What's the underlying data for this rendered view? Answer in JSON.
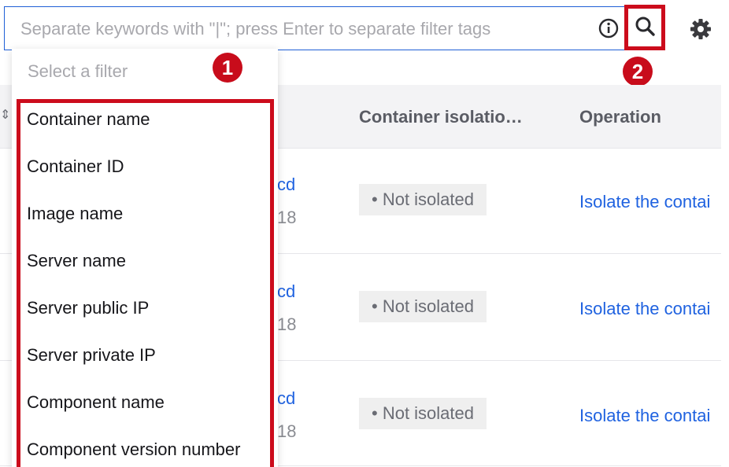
{
  "search": {
    "placeholder": "Separate keywords with \"|\"; press Enter to separate filter tags"
  },
  "icons": {
    "info": "info-circle-icon",
    "search": "search-icon",
    "settings": "gear-icon",
    "sort": "sort-icon"
  },
  "callouts": {
    "one": "1",
    "two": "2"
  },
  "colors": {
    "accent": "#1f5fd6",
    "highlight": "#cc0c1c",
    "link": "#1f62e0"
  },
  "table": {
    "columns": [
      "Container isolatio…",
      "Operation"
    ],
    "rows": [
      {
        "id_fragment": "cd",
        "sub_fragment": "18",
        "status": "• Not isolated",
        "operation": "Isolate the contai"
      },
      {
        "id_fragment": "cd",
        "sub_fragment": "18",
        "status": "• Not isolated",
        "operation": "Isolate the contai"
      },
      {
        "id_fragment": "cd",
        "sub_fragment": "18",
        "status": "• Not isolated",
        "operation": "Isolate the contai"
      }
    ]
  },
  "dropdown": {
    "header": "Select a filter",
    "items": [
      "Container name",
      "Container ID",
      "Image name",
      "Server name",
      "Server public IP",
      "Server private IP",
      "Component name",
      "Component version number"
    ]
  }
}
